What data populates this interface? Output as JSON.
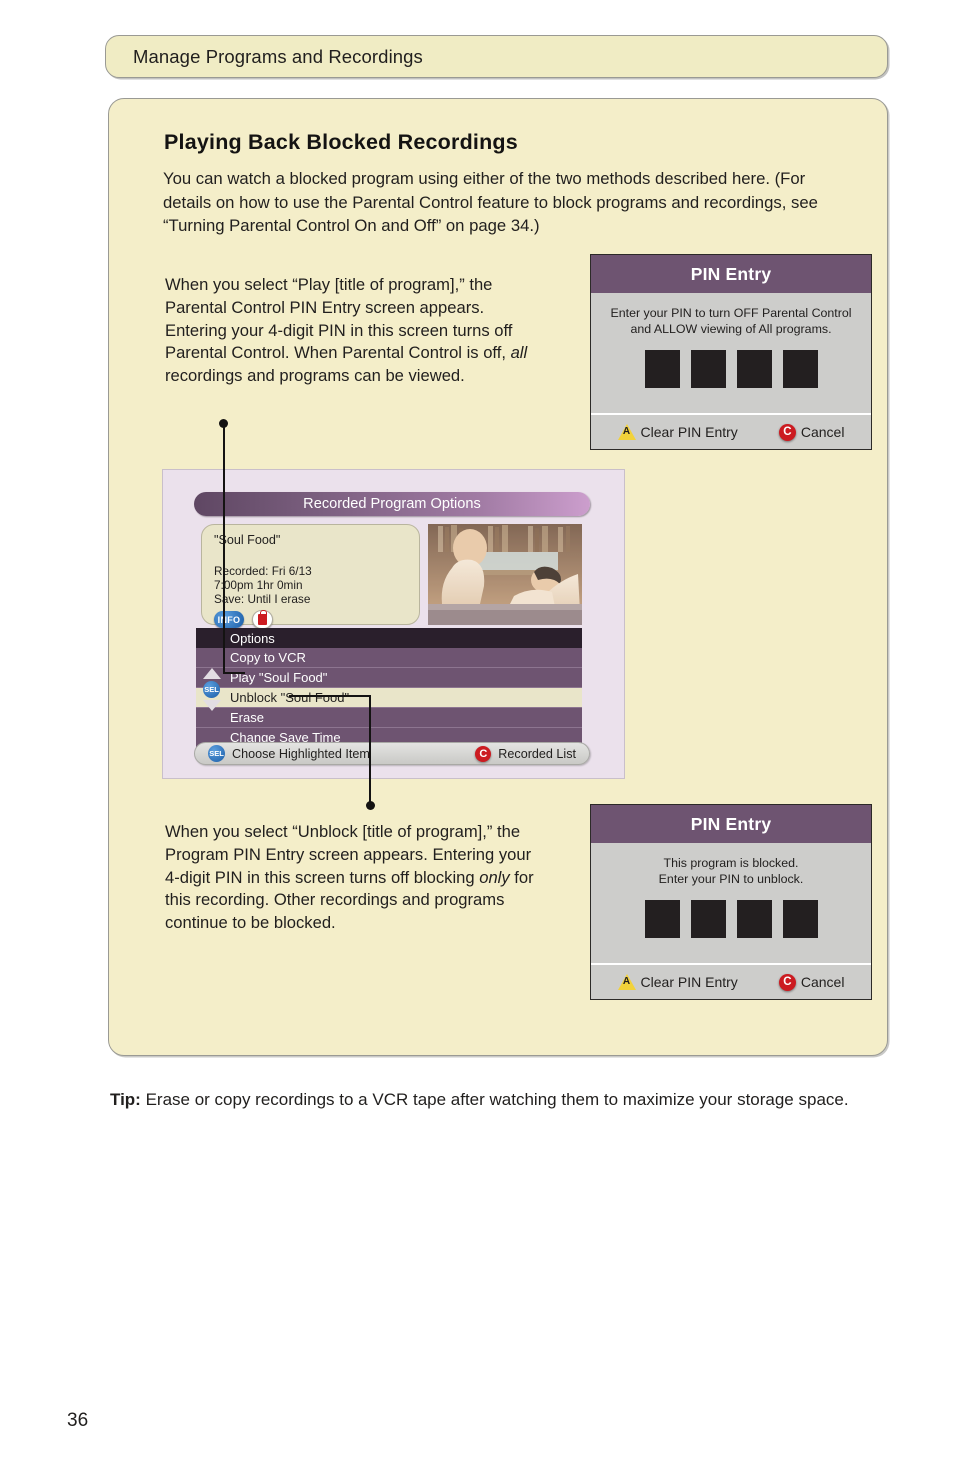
{
  "running_head": "Manage Programs and Recordings",
  "section": {
    "title": "Playing Back Blocked Recordings",
    "intro": "You can watch a blocked program using either of the two methods described here. (For details on how to use the Parental Control feature to block programs and recordings, see “Turning Parental Control On and Off” on page 34.)"
  },
  "callouts": {
    "top": {
      "part1": "When you select “Play [title of program],” the Parental Control PIN Entry screen appears. Entering your 4-digit PIN in this screen turns off Parental Control. When Parental Control is off, ",
      "emphasis": "all",
      "part2": " recordings and programs can be viewed."
    },
    "bottom": {
      "part1": "When you select “Unblock [title of program],” the Program PIN Entry screen appears. Entering your 4-digit PIN in this screen turns off blocking ",
      "emphasis": "only",
      "part2": " for this recording. Other recordings and programs continue to be blocked."
    }
  },
  "pin_dialog_parental": {
    "title": "PIN Entry",
    "message_line1": "Enter your PIN to turn OFF Parental Control",
    "message_line2": "and ALLOW viewing of All programs.",
    "digit_count": 4,
    "clear_label": "Clear PIN Entry",
    "clear_icon": "yellow-triangle-a-icon",
    "cancel_label": "Cancel",
    "cancel_icon": "red-circle-c-icon"
  },
  "pin_dialog_program": {
    "title": "PIN Entry",
    "message_line1": "This program is blocked.",
    "message_line2": "Enter your PIN to unblock.",
    "digit_count": 4,
    "clear_label": "Clear PIN Entry",
    "clear_icon": "yellow-triangle-a-icon",
    "cancel_label": "Cancel",
    "cancel_icon": "red-circle-c-icon"
  },
  "tv_screen": {
    "header": "Recorded Program Options",
    "info_card": {
      "program_title": "\"Soul Food\"",
      "recorded": "Recorded: Fri  6/13",
      "time": "7:00pm  1hr  0min",
      "save": "Save: Until I erase",
      "info_badge": "INFO",
      "lock_badge": "locked-padlock-icon"
    },
    "list_header": "Options",
    "options": [
      {
        "label": "Copy to VCR",
        "selected": false
      },
      {
        "label": "Play \"Soul Food\"",
        "selected": false
      },
      {
        "label": "Unblock \"Soul Food\"",
        "selected": true
      },
      {
        "label": "Erase",
        "selected": false
      },
      {
        "label": "Change Save Time",
        "selected": false
      }
    ],
    "nav": {
      "up": "up-arrow-icon",
      "sel": "SEL",
      "down": "down-arrow-icon"
    },
    "footer": {
      "left_icon": "SEL",
      "left_label": "Choose Highlighted Item",
      "right_icon": "C",
      "right_label": "Recorded List"
    }
  },
  "tip": {
    "label": "Tip:",
    "text": " Erase or copy recordings to a VCR tape after watching them to maximize your storage space."
  },
  "page_number": "36",
  "colors": {
    "page_bg": "#ffffff",
    "panel_bg": "#f4eec9",
    "panel_border": "#9a9a94",
    "dialog_title_bg": "#6e5471",
    "dialog_body_bg": "#cdcdcb",
    "tv_bg": "#ebe1ec",
    "tv_row_bg": "#6e5471",
    "tv_row_selected_bg": "#e9e5c9",
    "accent_red": "#cc1b21",
    "accent_yellow": "#f2d23a",
    "accent_blue": "#1c5ea8"
  }
}
